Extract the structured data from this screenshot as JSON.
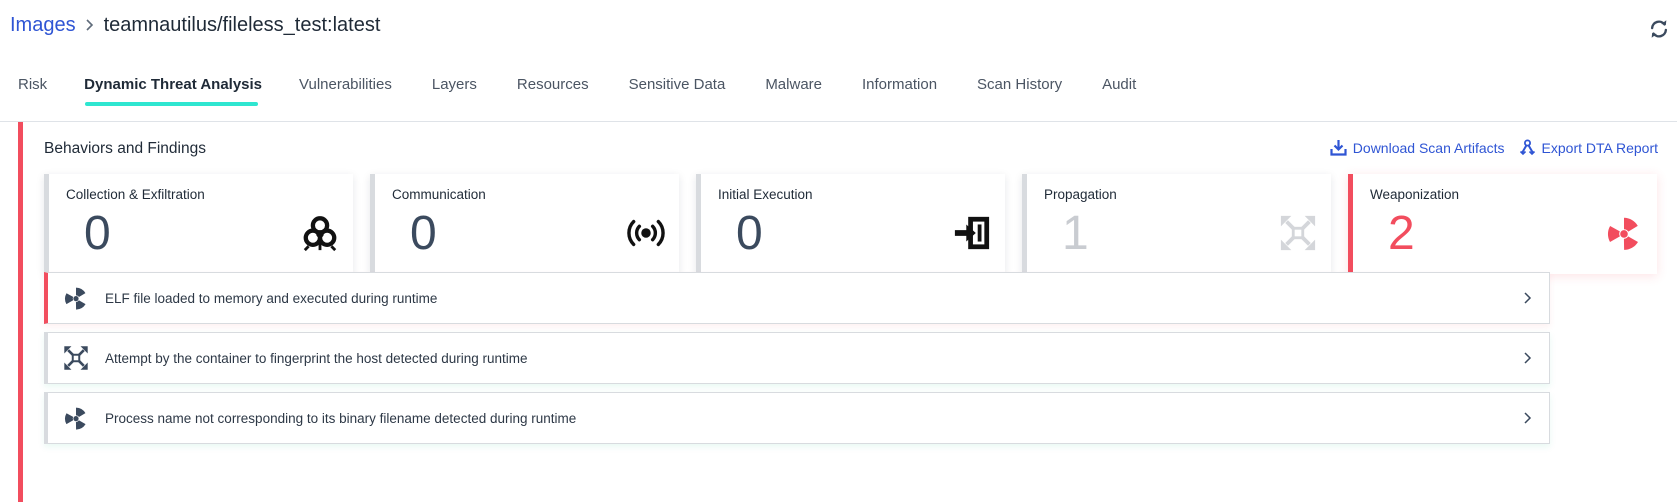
{
  "breadcrumb": {
    "root": "Images",
    "current": "teamnautilus/fileless_test:latest"
  },
  "tabs": [
    {
      "label": "Risk",
      "active": false
    },
    {
      "label": "Dynamic Threat Analysis",
      "active": true
    },
    {
      "label": "Vulnerabilities",
      "active": false
    },
    {
      "label": "Layers",
      "active": false
    },
    {
      "label": "Resources",
      "active": false
    },
    {
      "label": "Sensitive Data",
      "active": false
    },
    {
      "label": "Malware",
      "active": false
    },
    {
      "label": "Information",
      "active": false
    },
    {
      "label": "Scan History",
      "active": false
    },
    {
      "label": "Audit",
      "active": false
    }
  ],
  "section": {
    "title": "Behaviors and Findings",
    "download_label": "Download Scan Artifacts",
    "export_label": "Export DTA Report"
  },
  "cards": [
    {
      "title": "Collection & Exfiltration",
      "count": "0",
      "icon": "biohazard-icon"
    },
    {
      "title": "Communication",
      "count": "0",
      "icon": "broadcast-icon"
    },
    {
      "title": "Initial Execution",
      "count": "0",
      "icon": "enter-icon"
    },
    {
      "title": "Propagation",
      "count": "1",
      "icon": "expand-arrows-icon"
    },
    {
      "title": "Weaponization",
      "count": "2",
      "icon": "radiation-icon"
    }
  ],
  "findings": [
    {
      "text": "ELF file loaded to memory and executed during runtime",
      "icon": "radiation-icon",
      "severity": "critical"
    },
    {
      "text": "Attempt by the container to fingerprint the host detected during runtime",
      "icon": "expand-arrows-icon",
      "severity": "low"
    },
    {
      "text": "Process name not corresponding to its binary filename detected during runtime",
      "icon": "radiation-icon",
      "severity": "low"
    }
  ],
  "colors": {
    "accent": "#2f55d4",
    "critical": "#f24d5e",
    "tab_indicator": "#2ee6d0",
    "dark_text": "#1f2a37"
  }
}
